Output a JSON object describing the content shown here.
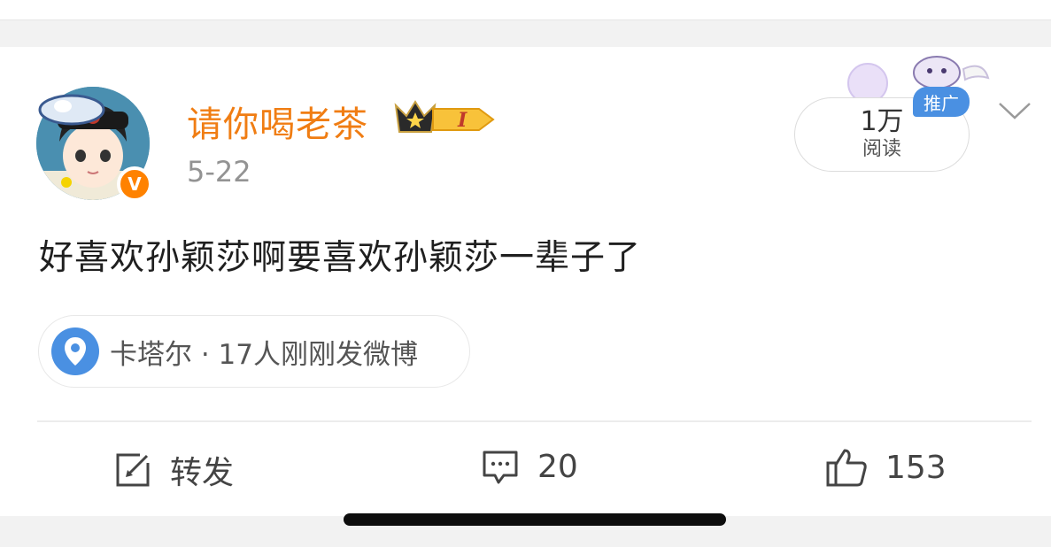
{
  "post": {
    "username": "请你喝老茶",
    "level_badge": "I",
    "verified_mark": "V",
    "date": "5-22",
    "read_count": "1万",
    "read_label": "阅读",
    "promo_tag": "推广",
    "text": "好喜欢孙颖莎啊要喜欢孙颖莎一辈子了",
    "location": "卡塔尔 · 17人刚刚发微博"
  },
  "actions": {
    "repost_label": "转发",
    "comment_count": "20",
    "like_count": "153"
  },
  "colors": {
    "username": "#f07d13",
    "verify": "#ff8200",
    "promo": "#4a90e2",
    "pin": "#4a90e2"
  },
  "icons": [
    "avatar",
    "crown-icon",
    "verified-icon",
    "chevron-down-icon",
    "location-pin-icon",
    "repost-icon",
    "comment-icon",
    "like-icon"
  ]
}
